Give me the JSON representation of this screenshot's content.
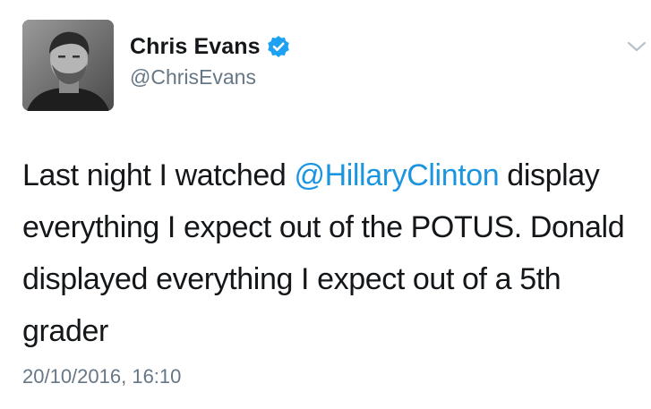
{
  "tweet": {
    "author": {
      "display_name": "Chris Evans",
      "handle": "@ChrisEvans",
      "verified": true,
      "avatar_icon": "profile-photo"
    },
    "text": {
      "before_mention": "Last night I watched ",
      "mention": "@HillaryClinton",
      "after_mention": " display everything I expect out of the POTUS. Donald displayed everything I expect out of a 5th grader"
    },
    "timestamp": "20/10/2016, 16:10",
    "menu_icon": "chevron-down-icon"
  },
  "colors": {
    "text": "#14171a",
    "secondary": "#657786",
    "link": "#1b95e0",
    "verified": "#1da1f2"
  }
}
